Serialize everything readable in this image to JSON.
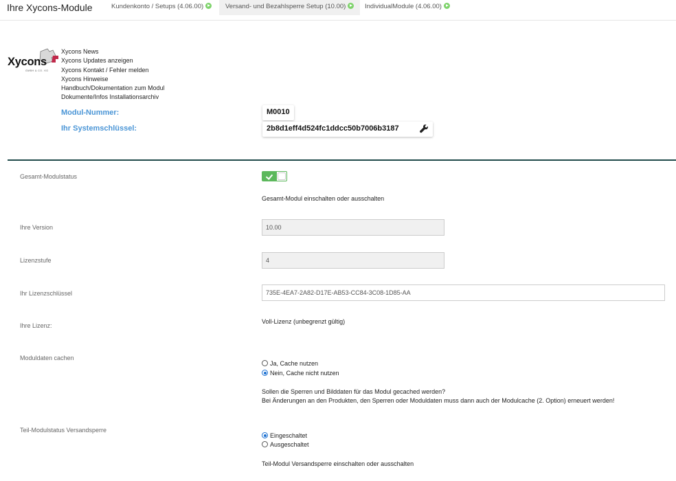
{
  "header": {
    "title": "Ihre Xycons-Module",
    "tabs": [
      {
        "label": "Kundenkonto / Setups (4.06.00)",
        "active": false
      },
      {
        "label": "Versand- und Bezahlsperre Setup (10.00)",
        "active": true
      },
      {
        "label": "IndividualModule (4.06.00)",
        "active": false
      }
    ]
  },
  "logo": {
    "text": "Xycons",
    "sub": "GMBH & CO. KG"
  },
  "links": [
    "Xycons News",
    "Xycons Updates anzeigen",
    "Xycons Kontakt / Fehler melden",
    "Xycons Hinweise",
    "Handbuch/Dokumentation zum Modul",
    "Dokumente/Infos Installationsarchiv"
  ],
  "module": {
    "number_label": "Modul-Nummer:",
    "number": "M0010",
    "syskey_label": "Ihr Systemschlüssel:",
    "syskey": "2b8d1eff4d524fc1ddcc50b7006b3187"
  },
  "form": {
    "status": {
      "label": "Gesamt-Modulstatus",
      "help": "Gesamt-Modul einschalten oder ausschalten",
      "enabled": true
    },
    "version": {
      "label": "Ihre Version",
      "value": "10.00"
    },
    "level": {
      "label": "Lizenzstufe",
      "value": "4"
    },
    "licensekey": {
      "label": "Ihr Lizenzschlüssel",
      "value": "735E-4EA7-2A82-D17E-AB53-CC84-3C08-1D85-AA"
    },
    "license": {
      "label": "Ihre Lizenz:",
      "value": "Voll-Lizenz (unbegrenzt gültig)"
    },
    "cache": {
      "label": "Moduldaten cachen",
      "options": [
        {
          "label": "Ja, Cache nutzen",
          "checked": false
        },
        {
          "label": "Nein, Cache nicht nutzen",
          "checked": true
        }
      ],
      "help1": "Sollen die Sperren und Bilddaten für das Modul gecached werden?",
      "help2": "Bei Änderungen an den Produkten, den Sperren oder Moduldaten muss dann auch der Modulcache (2. Option) erneuert werden!"
    },
    "partial": {
      "label": "Teil-Modulstatus Versandsperre",
      "options": [
        {
          "label": "Eingeschaltet",
          "checked": true
        },
        {
          "label": "Ausgeschaltet",
          "checked": false
        }
      ],
      "help": "Teil-Modul Versandsperre einschalten oder ausschalten"
    }
  },
  "colors": {
    "accent": "#4a95d6",
    "toggle_on": "#5cb85c",
    "divider": "#1f4a4a",
    "tab_dot": "#7ed36b"
  }
}
